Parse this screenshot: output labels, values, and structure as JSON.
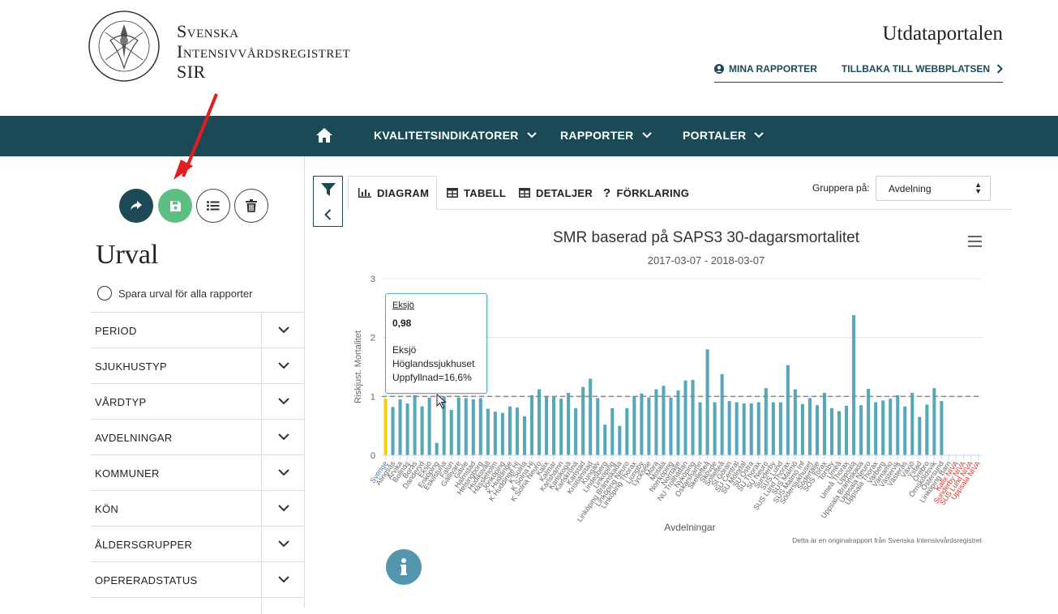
{
  "header": {
    "brand_line1": "Svenska",
    "brand_line2": "Intensivvårdsregistret",
    "brand_line3": "SIR",
    "seal_text": "SOCIETAS SVECICA · ANAESTHESIOLOGIAE CVRAEQVE INTENSIVAE",
    "portal_title": "Utdataportalen",
    "link_my_reports": "MINA RAPPORTER",
    "link_back": "TILLBAKA TILL WEBBPLATSEN"
  },
  "nav": {
    "items": [
      "KVALITETSINDIKATORER",
      "RAPPORTER",
      "PORTALER"
    ]
  },
  "sidebar": {
    "title": "Urval",
    "save_all_label": "Spara urval för alla rapporter",
    "filters": [
      "PERIOD",
      "SJUKHUSTYP",
      "VÅRDTYP",
      "AVDELNINGAR",
      "KOMMUNER",
      "KÖN",
      "ÅLDERSGRUPPER",
      "OPERERADSTATUS"
    ]
  },
  "tabs": {
    "diagram": "DIAGRAM",
    "tabell": "TABELL",
    "detaljer": "DETALJER",
    "forklaring": "FÖRKLARING"
  },
  "group": {
    "label": "Gruppera på:",
    "value": "Avdelning"
  },
  "tooltip": {
    "name": "Eksjö",
    "value": "0,98",
    "line1": "Eksjö",
    "line2": "Höglandssjukhuset",
    "line3": "Uppfyllnad=16,6%"
  },
  "colors": {
    "teal_dark": "#1b4a56",
    "bar": "#56a8b9",
    "highlight": "#f0cf0c",
    "save_green": "#5cc083",
    "red_label": "#d9332a",
    "blue_label": "#4a7ab0"
  },
  "chart_data": {
    "type": "bar",
    "title": "SMR baserad på SAPS3 30-dagarsmortalitet",
    "subtitle": "2017-03-07 - 2018-03-07",
    "xlabel": "Avdelningar",
    "ylabel": "Riskjust. Mortalitet",
    "ylim": [
      0,
      3
    ],
    "yticks": [
      0,
      1,
      2,
      3
    ],
    "reference_line": 1,
    "source_note": "Detta är en originalrapport från Svenska Intensivvårdsregistret",
    "categories": [
      "Sverige",
      "Alingsås",
      "Arvika",
      "Bollnäs",
      "Borås",
      "Danderyd",
      "Eksjö",
      "Enköping",
      "Eskilstuna",
      "Falun",
      "Gällivare",
      "Gävle",
      "Halmstad",
      "Helsingborg",
      "Hudiksvall",
      "Hässleholm",
      "Jönköping",
      "K Huddinge",
      "K Huddinge Hj",
      "K Solna",
      "K Solna Hj",
      "K Solna Neuro",
      "Kalix",
      "Kalmar",
      "Karlshamn",
      "Karlskoga",
      "Karlskrona",
      "Karlstad",
      "Kristianstad",
      "Kungälv",
      "Lindesberg",
      "Linköping",
      "Linköping Brännskada",
      "Linköping Neuro",
      "Linköping Thorax",
      "Ljungby",
      "Lycksele",
      "Mora",
      "Motala",
      "Norrköping",
      "Norrtälje",
      "NU Trollhättan",
      "Nyköping",
      "Oskarshamn",
      "Skellefteå",
      "Skövde",
      "Sollefteå",
      "St Göran",
      "SU Central",
      "SU Mölndal",
      "SU Östra",
      "SU Thorax",
      "SU Neuro",
      "Sunderby",
      "SUS Lund",
      "SUS Lund Thorax",
      "SUS Malmö",
      "SUS Malmö Inf",
      "Södersjukhuset",
      "Södertälje",
      "SÖS Torax",
      "Torsby",
      "Umeå",
      "Umeå Thorax",
      "Uppsala",
      "Uppsala Brännskada",
      "Uppsala Neuro",
      "Uppsala Thorax",
      "Varberg",
      "Värnamo",
      "Västervik",
      "Västerås",
      "Växjö",
      "Ystad",
      "Örebro",
      "Örnsköldsvik",
      "Östersund",
      "Linköping Barn",
      "Kalix NIVA",
      "Sunderby NIVA",
      "SUS Lund NIVA",
      "Uppsala NIVA"
    ],
    "values": [
      0.96,
      0.82,
      0.95,
      0.88,
      1.02,
      0.83,
      0.98,
      0.21,
      1.0,
      0.77,
      0.98,
      0.97,
      0.95,
      0.97,
      0.79,
      0.74,
      0.72,
      0.83,
      0.81,
      0.66,
      1.02,
      1.12,
      1.0,
      1.0,
      0.96,
      1.06,
      0.8,
      1.16,
      1.3,
      0.97,
      0.52,
      0.8,
      0.5,
      0.8,
      1.0,
      1.05,
      0.98,
      1.12,
      1.18,
      0.98,
      1.1,
      1.27,
      1.28,
      0.9,
      1.8,
      0.9,
      1.38,
      0.92,
      0.9,
      0.88,
      0.88,
      0.9,
      1.14,
      0.9,
      0.9,
      1.53,
      1.12,
      0.87,
      0.97,
      0.85,
      1.06,
      0.8,
      0.75,
      0.84,
      2.38,
      0.85,
      1.13,
      0.9,
      0.93,
      0.96,
      1.02,
      0.83,
      1.06,
      0.65,
      0.86,
      1.14,
      0.92,
      0,
      0,
      0,
      0,
      0
    ],
    "highlight_category": "Sverige",
    "red_categories": [
      "Kalix NIVA",
      "Sunderby NIVA",
      "SUS Lund NIVA",
      "Uppsala NIVA"
    ]
  }
}
